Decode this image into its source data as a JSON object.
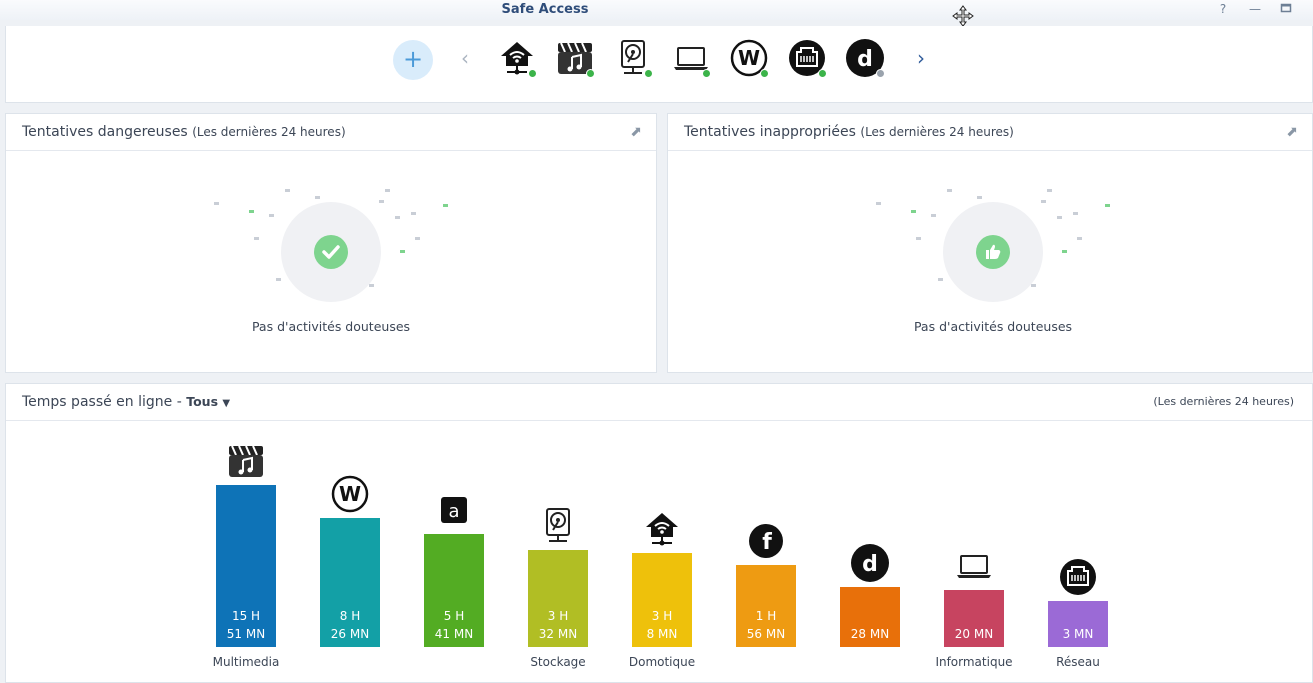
{
  "window": {
    "title": "Safe Access"
  },
  "devices": [
    {
      "icon": "home-router-icon",
      "status_color": "#3cb44a"
    },
    {
      "icon": "multimedia-icon",
      "status_color": "#3cb44a"
    },
    {
      "icon": "storage-icon",
      "status_color": "#3cb44a"
    },
    {
      "icon": "laptop-icon",
      "status_color": "#3cb44a"
    },
    {
      "icon": "w-logo-icon",
      "status_color": "#3cb44a"
    },
    {
      "icon": "network-port-icon",
      "status_color": "#3cb44a"
    },
    {
      "icon": "d-logo-icon",
      "status_color": "#9aa3ad"
    }
  ],
  "dangerous": {
    "title": "Tentatives dangereuses",
    "subtitle": "(Les dernières 24 heures)",
    "empty_text": "Pas d'activités douteuses"
  },
  "inappropriate": {
    "title": "Tentatives inappropriées",
    "subtitle": "(Les dernières 24 heures)",
    "empty_text": "Pas d'activités douteuses"
  },
  "online": {
    "title": "Temps passé en ligne - ",
    "filter": "Tous",
    "period": "(Les dernières 24 heures)"
  },
  "chart_data": {
    "type": "bar",
    "categories": [
      "Multimedia",
      "",
      "",
      "Stockage",
      "Domotique",
      "",
      "",
      "Informatique",
      "Réseau"
    ],
    "values_minutes": [
      951,
      506,
      341,
      212,
      188,
      116,
      28,
      20,
      3
    ],
    "value_labels": [
      [
        "15 H",
        "51 MN"
      ],
      [
        "8 H",
        "26 MN"
      ],
      [
        "5 H",
        "41 MN"
      ],
      [
        "3 H",
        "32 MN"
      ],
      [
        "3 H",
        "8 MN"
      ],
      [
        "1 H",
        "56 MN"
      ],
      [
        "",
        "28 MN"
      ],
      [
        "",
        "20 MN"
      ],
      [
        "",
        "3 MN"
      ]
    ],
    "colors": [
      "#0e73b7",
      "#13a0a6",
      "#53ac23",
      "#b1be24",
      "#eec10b",
      "#ee9b12",
      "#e8700a",
      "#c74460",
      "#9b6ad6"
    ],
    "icons": [
      "multimedia-icon",
      "w-logo-icon",
      "a-logo-icon",
      "storage-icon",
      "home-router-icon",
      "f-logo-icon",
      "d-logo-icon",
      "laptop-icon",
      "network-port-icon"
    ]
  }
}
